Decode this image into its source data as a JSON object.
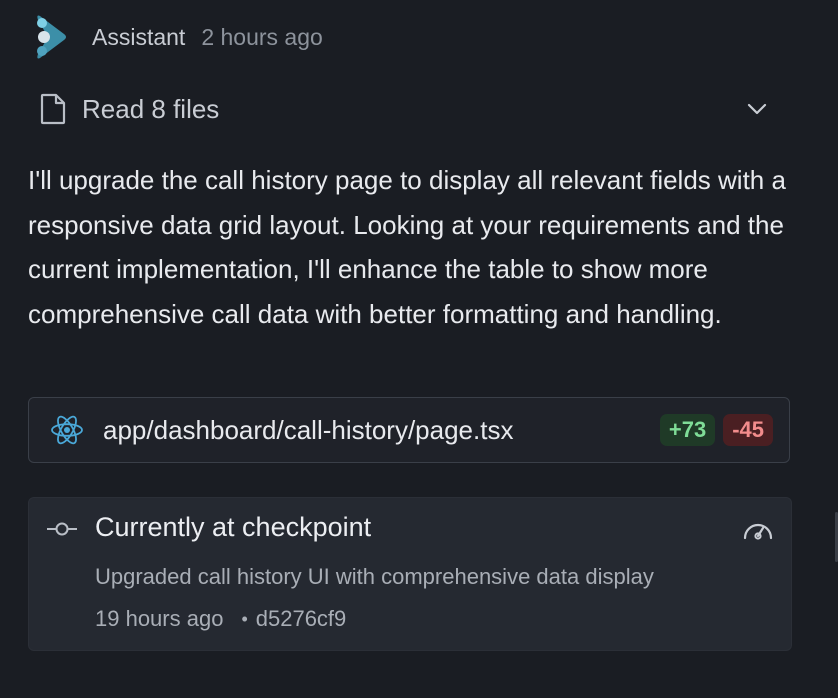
{
  "header": {
    "author": "Assistant",
    "time": "2 hours ago",
    "logo_icon": "assistant-logo-icon"
  },
  "read_files": {
    "label": "Read 8 files",
    "icon": "file-icon",
    "toggle_icon": "chevron-down-icon"
  },
  "message": {
    "text": "I'll upgrade the call history page to display all relevant fields with a responsive data grid layout. Looking at your requirements and the current implementation, I'll enhance the table to show more comprehensive call data with better formatting and handling."
  },
  "file_change": {
    "path": "app/dashboard/call-history/page.tsx",
    "additions": "+73",
    "deletions": "-45",
    "icon": "react-icon"
  },
  "checkpoint": {
    "title": "Currently at checkpoint",
    "description": "Upgraded call history UI with comprehensive data display",
    "time": "19 hours ago",
    "separator": "•",
    "hash": "d5276cf9",
    "icon": "commit-icon",
    "action_icon": "gauge-icon"
  },
  "colors": {
    "background": "#1a1d23",
    "card": "#252931",
    "add_badge": "#7fdc97",
    "del_badge": "#f28c8c",
    "react_blue": "#4aa8d8"
  }
}
